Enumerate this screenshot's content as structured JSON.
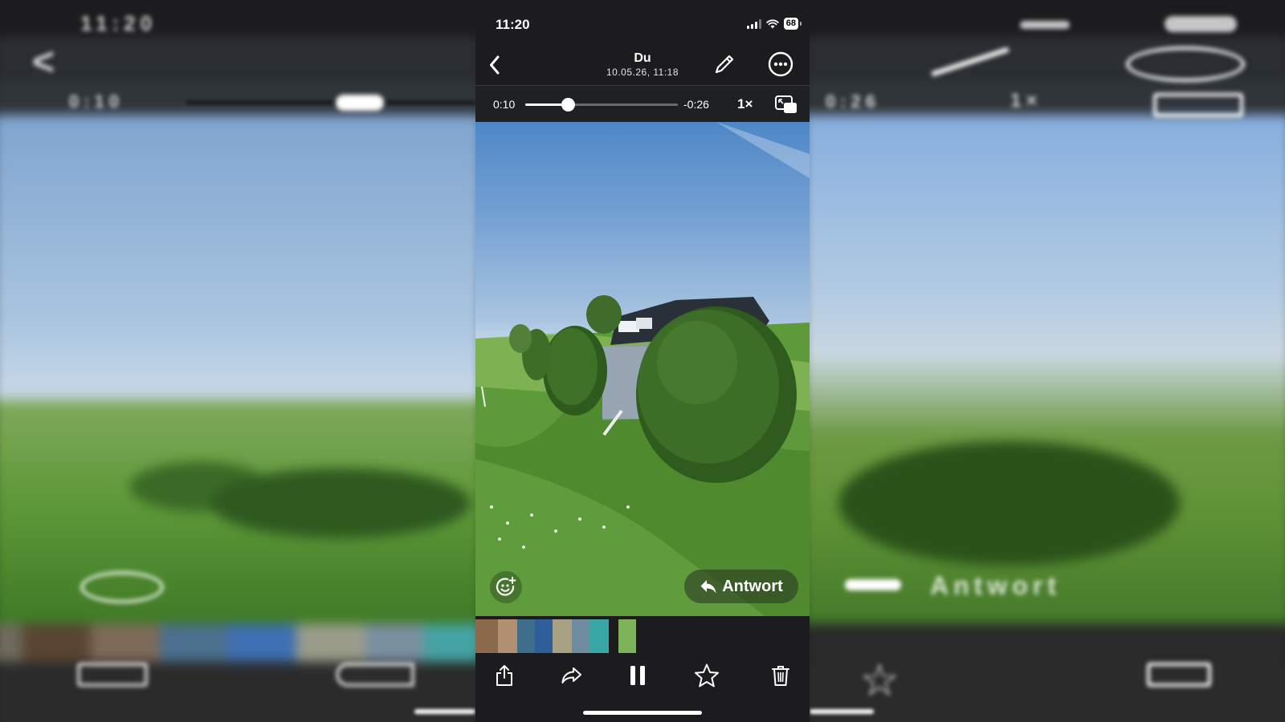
{
  "status_bar": {
    "time": "11:20",
    "battery": "68"
  },
  "header": {
    "title": "Du",
    "subtitle": "10.05.26, 11:18"
  },
  "player": {
    "current_time": "0:10",
    "remaining_time": "-0:26",
    "speed": "1×",
    "progress": 0.28
  },
  "video_overlay": {
    "reply_label": "Antwort"
  },
  "ghost_text": {
    "left_time": "11:20",
    "left_elapsed": "0:10",
    "right_remaining": "0:26",
    "right_speed": "1×",
    "right_reply": "Antwort"
  },
  "icons": {
    "back": "chevron-left-icon",
    "edit": "pencil-icon",
    "more": "ellipsis-circle-icon",
    "pip": "picture-in-picture-icon",
    "react": "emoji-add-icon",
    "reply": "reply-arrow-icon",
    "share": "share-icon",
    "forward": "forward-icon",
    "pause": "pause-icon",
    "favorite": "star-icon",
    "delete": "trash-icon"
  },
  "thumbnails": [
    "#8a6a4a",
    "#b09070",
    "#3f6d8c",
    "#2f5f9a",
    "#a8a184",
    "#6f8d9f",
    "#3aa7a7",
    "#7fb35a"
  ]
}
